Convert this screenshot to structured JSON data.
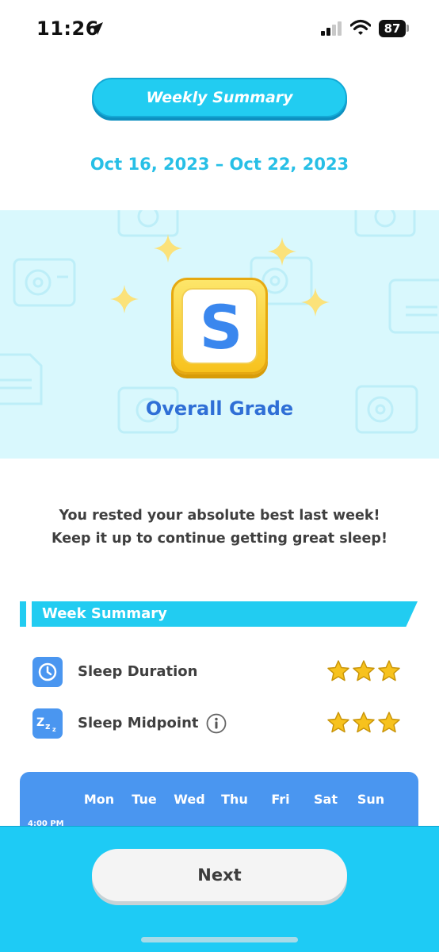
{
  "status_bar": {
    "time": "11:26",
    "battery": "87",
    "icons": [
      "location-arrow-icon",
      "signal-bars-icon",
      "wifi-icon",
      "battery-icon"
    ]
  },
  "header": {
    "title": "Weekly Summary",
    "date_range": "Oct 16, 2023 – Oct 22, 2023"
  },
  "grade": {
    "letter": "S",
    "caption": "Overall Grade"
  },
  "message": {
    "line1": "You rested your absolute best last week!",
    "line2": "Keep it up to continue getting great sleep!"
  },
  "week_summary": {
    "title": "Week Summary",
    "metrics": [
      {
        "label": "Sleep Duration",
        "icon": "clock-icon",
        "stars": 3,
        "max_stars": 3
      },
      {
        "label": "Sleep Midpoint",
        "icon": "zzz-icon",
        "stars": 3,
        "max_stars": 3,
        "info_icon": "info-icon"
      }
    ]
  },
  "chart": {
    "days": [
      "Mon",
      "Tue",
      "Wed",
      "Thu",
      "Fri",
      "Sat",
      "Sun"
    ],
    "first_time_label": "4:00 PM"
  },
  "footer": {
    "next_label": "Next"
  },
  "colors": {
    "accent_cyan": "#22ccf1",
    "grade_blue": "#3a87ee",
    "star_gold": "#f7c21d",
    "band_bg": "#d9f8fd",
    "chart_blue": "#4a96f0"
  }
}
